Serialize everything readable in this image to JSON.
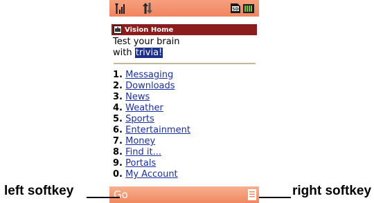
{
  "status_bar": {
    "icons": [
      "signal-strength-icon",
      "data-transfer-icon",
      "sd-card-icon",
      "battery-icon"
    ]
  },
  "title_bar": {
    "icon": "home-icon",
    "title": "Vision Home"
  },
  "promo": {
    "line1": "Test your brain",
    "line2_prefix": "with ",
    "line2_highlight": "trivia!"
  },
  "menu": {
    "items": [
      {
        "num": "1.",
        "label": "Messaging"
      },
      {
        "num": "2.",
        "label": "Downloads"
      },
      {
        "num": "3.",
        "label": "News"
      },
      {
        "num": "4.",
        "label": "Weather"
      },
      {
        "num": "5.",
        "label": "Sports"
      },
      {
        "num": "6.",
        "label": "Entertainment"
      },
      {
        "num": "7.",
        "label": "Money"
      },
      {
        "num": "8.",
        "label": "Find it..."
      },
      {
        "num": "9.",
        "label": "Portals"
      },
      {
        "num": "0.",
        "label": "My Account"
      }
    ]
  },
  "softkeys": {
    "left_label": "Go",
    "right_icon": "menu-list-icon"
  },
  "callouts": {
    "left": "left softkey",
    "right": "right softkey"
  },
  "colors": {
    "bar": "#f1845f",
    "title_bg": "#8b1e1c",
    "link": "#1a2fa0",
    "highlight": "#1c2f8a"
  }
}
